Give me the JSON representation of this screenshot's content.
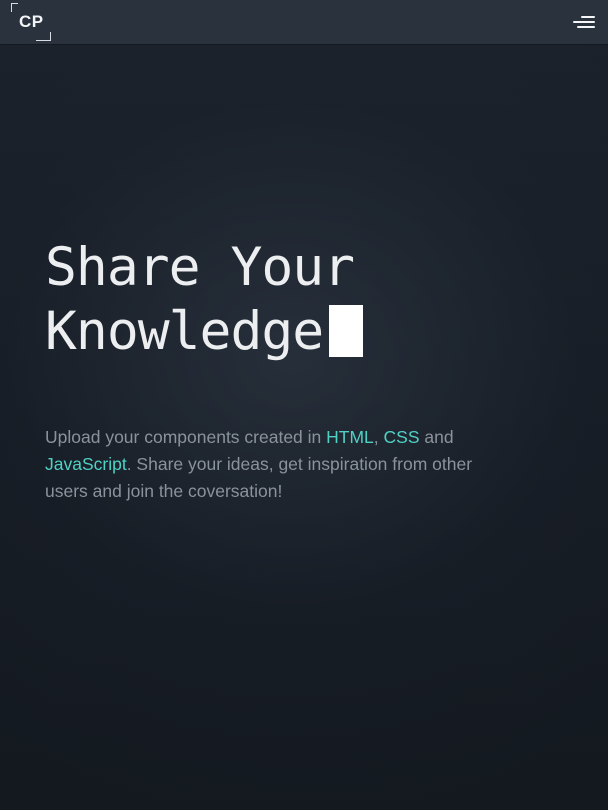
{
  "navbar": {
    "logo_text": "CP",
    "menu_icon": "hamburger-menu-icon"
  },
  "hero": {
    "title_line1": "Share Your",
    "title_line2": "Knowledge",
    "text_part1": "Upload your components created in ",
    "link_html": "HTML",
    "text_sep": ", ",
    "link_css": "CSS",
    "text_part2": " and ",
    "link_js": "JavaScript",
    "text_part3": ". Share your ideas, get inspiration from other users and join the coversation!"
  },
  "colors": {
    "background": "#161c24",
    "navbar": "#2a323e",
    "accent_link": "#4fd1c5",
    "body_text": "#8a929c",
    "title_text": "#eceef0"
  }
}
